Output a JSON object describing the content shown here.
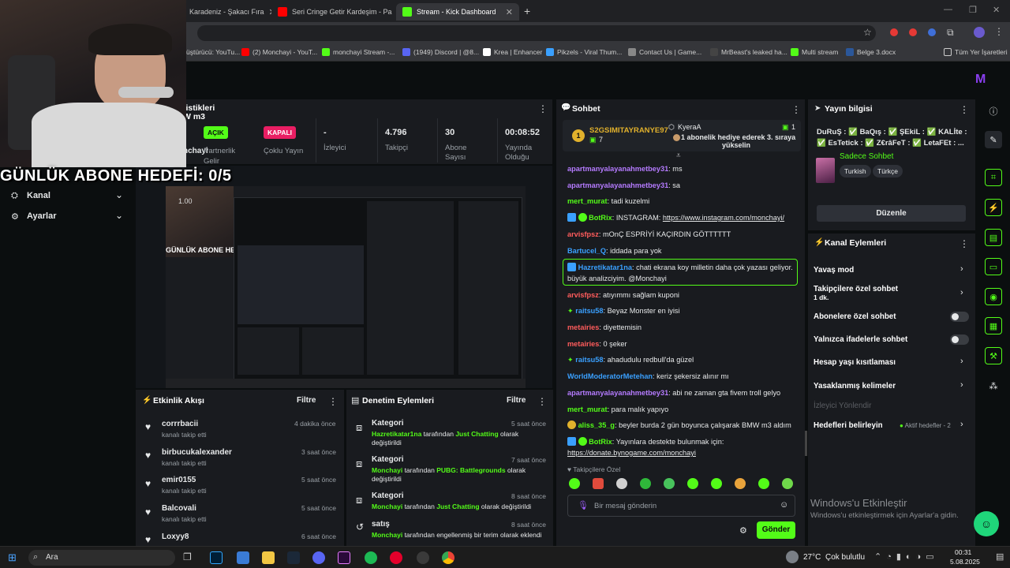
{
  "browser": {
    "tabs": [
      {
        "label": "Karadeniz - Şakacı Fıra",
        "color": "#ff0000"
      },
      {
        "label": "Seri Cringe Getir Kardeşim - Pa",
        "color": "#ff0000"
      },
      {
        "label": "Stream - Kick Dashboard",
        "color": "#53fc18"
      }
    ],
    "new_tab": "+",
    "bookmarks": [
      {
        "label": "üştürücü: YouTu...",
        "color": "#ff0000"
      },
      {
        "label": "(2) Monchayi - YouT...",
        "color": "#ff0000"
      },
      {
        "label": "monchayi Stream -...",
        "color": "#53fc18"
      },
      {
        "label": "(1949) Discord | @8...",
        "color": "#5865f2"
      },
      {
        "label": "Krea | Enhancer",
        "color": "#ffffff"
      },
      {
        "label": "Pikzels - Viral Thum...",
        "color": "#3aa0ff"
      },
      {
        "label": "Contact Us | Game...",
        "color": "#888888"
      },
      {
        "label": "MrBeast's leaked ha...",
        "color": "#444444"
      },
      {
        "label": "Multi stream",
        "color": "#53fc18"
      },
      {
        "label": "Belge 3.docx",
        "color": "#2b579a"
      },
      {
        "label": "Tüm Yer İşaretleri",
        "color": "#cccccc"
      }
    ]
  },
  "overlay": {
    "sub_goal": "GÜNLÜK ABONE HEDEFİ: 0/5"
  },
  "stats": {
    "title_partial": "tistikleri",
    "subtitle_partial": "W m3",
    "partner_badge": "AÇIK",
    "partner_label": "Partnerlik",
    "partner_label2": "Gelir",
    "multi_badge": "KAPALI",
    "multi_label": "Çoklu Yayın",
    "viewers_value": "-",
    "viewers_label": "İzleyici",
    "followers_value": "4.796",
    "followers_label": "Takipçi",
    "subs_value": "30",
    "subs_label": "Abone Sayısı",
    "uptime_value": "00:08:52",
    "uptime_label": "Yayında Olduğu",
    "partial_name": "nchayi"
  },
  "sidebar": {
    "items": [
      {
        "label": "Kanal",
        "icon": "channel-icon"
      },
      {
        "label": "Ayarlar",
        "icon": "gear-icon"
      }
    ]
  },
  "preview": {
    "overlay_text": "GÜNLÜK ABONE HEDEFİ: 0/5",
    "time": "1.00"
  },
  "activity": {
    "title": "Etkinlik Akışı",
    "filter": "Filtre",
    "items": [
      {
        "name": "corrrbacii",
        "sub": "kanalı takip etti",
        "time": "4 dakika önce"
      },
      {
        "name": "birbucukalexander",
        "sub": "kanalı takip etti",
        "time": "3 saat önce"
      },
      {
        "name": "emir0155",
        "sub": "kanalı takip etti",
        "time": "5 saat önce"
      },
      {
        "name": "Balcovali",
        "sub": "kanalı takip etti",
        "time": "5 saat önce"
      },
      {
        "name": "Loxyy8",
        "sub": "",
        "time": "6 saat önce"
      }
    ]
  },
  "moderation": {
    "title": "Denetim Eylemleri",
    "filter": "Filtre",
    "items": [
      {
        "title": "Kategori",
        "time": "5 saat önce",
        "line1a": "Hazretikatar1na",
        "line1b": " tarafından ",
        "line1c": "Just Chatting",
        "line1d": " olarak",
        "line2": "değiştirildi"
      },
      {
        "title": "Kategori",
        "time": "7 saat önce",
        "line1a": "Monchayi",
        "line1b": " tarafından ",
        "line1c": "PUBG: Battlegrounds",
        "line1d": " olarak",
        "line2": "değiştirildi"
      },
      {
        "title": "Kategori",
        "time": "8 saat önce",
        "line1a": "Monchayi",
        "line1b": " tarafından ",
        "line1c": "Just Chatting",
        "line1d": " olarak değiştirildi",
        "line2": ""
      },
      {
        "title": "satış",
        "time": "8 saat önce",
        "line1a": "Monchayi",
        "line1b": " tarafından engellenmiş bir terim olarak eklendi",
        "line1c": "",
        "line1d": "",
        "line2": ""
      }
    ]
  },
  "chat": {
    "title": "Sohbet",
    "top_gifter_name": "S2GSIMITAYRANYE97",
    "top_gifter_count": "7",
    "top_gifter_rank": "1",
    "gift_user": "KyeraA",
    "gift_count": "1",
    "gift_text1": "1 abonelik hediye ederek 3. sıraya",
    "gift_text2": "yükselin",
    "messages": [
      {
        "user": "apartmanyalayanahmetbey31",
        "color": "#b57bff",
        "text": "ms",
        "badge": ""
      },
      {
        "user": "apartmanyalayanahmetbey31",
        "color": "#b57bff",
        "text": "sa",
        "badge": ""
      },
      {
        "user": "mert_murat",
        "color": "#53fc18",
        "text": "tadi kuzelmi",
        "badge": ""
      },
      {
        "user": "BotRix",
        "color": "#53fc18",
        "text": "INSTAGRAM: ",
        "link": "https://www.instagram.com/monchayi/",
        "badge": "bot"
      },
      {
        "user": "arvisfpsz",
        "color": "#ff5c5c",
        "text": "mOnÇ ESPRİYİ KAÇIRDIN GÖTTTTTT",
        "badge": ""
      },
      {
        "user": "Bartucel_Q",
        "color": "#3aa0ff",
        "text": "iddada para yok",
        "badge": ""
      },
      {
        "user": "Hazretikatar1na",
        "color": "#3aa0ff",
        "text": "chati ekrana koy milletin daha çok yazası geliyor.",
        "text2": "büyük analizciyim. @Monchayi",
        "badge": "mod"
      },
      {
        "user": "arvisfpsz",
        "color": "#ff5c5c",
        "text": "atıyımmı sağlam kuponi",
        "badge": ""
      },
      {
        "user": "raitsu58",
        "color": "#3aa0ff",
        "text": "Beyaz Monster en iyisi",
        "badge": "sparkle"
      },
      {
        "user": "metairies",
        "color": "#ff5c5c",
        "text": "diyettemisin",
        "badge": ""
      },
      {
        "user": "metairies",
        "color": "#ff5c5c",
        "text": "0 şeker",
        "badge": ""
      },
      {
        "user": "raitsu58",
        "color": "#3aa0ff",
        "text": "ahadudulu redbull'da güzel",
        "badge": "sparkle"
      },
      {
        "user": "WorldModeratorMetehan",
        "color": "#3aa0ff",
        "text": "keriz şekersiz alınır mı",
        "badge": ""
      },
      {
        "user": "apartmanyalayanahmetbey31",
        "color": "#b57bff",
        "text": "abi ne zaman gta fivem troll gelyo",
        "badge": ""
      },
      {
        "user": "mert_murat",
        "color": "#53fc18",
        "text": "para malık yapıyo",
        "badge": ""
      },
      {
        "user": "aliss_35_g",
        "color": "#53fc18",
        "text": "beyler burda 2 gün boyunca çalışarak BMW m3 aldım",
        "badge": "gift"
      },
      {
        "user": "BotRix",
        "color": "#53fc18",
        "text": "Yayınlara destekte bulunmak için:",
        "link2": "https://donate.bynogame.com/monchayi",
        "badge": "bot"
      }
    ],
    "followers_only": "Takipçilere Özel",
    "input_placeholder": "Bir mesaj gönderin",
    "send_label": "Gönder"
  },
  "stream_info": {
    "title": "Yayın bilgisi",
    "stream_title": "DuRuŞ : ✅ BaQış : ✅ ŞEkiL : ✅ KALİte : ✅ EsTetick : ✅ Z€râFeT : ✅ LetaFEt : ...",
    "category": "Sadece Sohbet",
    "tags": [
      "Turkish",
      "Türkçe"
    ],
    "edit_label": "Düzenle"
  },
  "channel_actions": {
    "title": "Kanal Eylemleri",
    "slow_mode": "Yavaş mod",
    "followers_chat": "Takipçilere özel sohbet",
    "followers_chat_sub": "1 dk.",
    "subs_chat": "Abonelere özel sohbet",
    "emote_chat": "Yalnızca ifadelerle sohbet",
    "age_restrict": "Hesap yaşı kısıtlaması",
    "banned_words": "Yasaklanmış kelimeler",
    "viewer_redirect": "İzleyici Yönlendir",
    "set_goals": "Hedefleri belirleyin",
    "goals_active": "Aktif hedefler - 2"
  },
  "windows": {
    "activate_title": "Windows'u Etkinleştir",
    "activate_sub": "Windows'u etkinleştirmek için Ayarlar'a gidin.",
    "search": "Ara",
    "weather_temp": "27°C",
    "weather_desc": "Çok bulutlu",
    "time": "00:31",
    "date": "5.08.2025"
  },
  "colors": {
    "accent": "#53fc18",
    "panel": "#191b1f",
    "bg": "#0b0e0f",
    "danger": "#e91e63"
  }
}
